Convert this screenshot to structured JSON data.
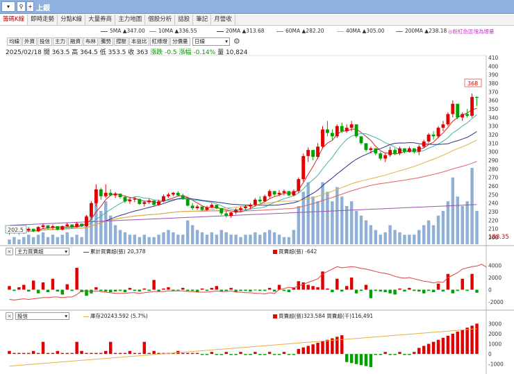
{
  "window": {
    "title": "上銀",
    "search_icon": "magnifier-icon",
    "plus": "+"
  },
  "tabs": [
    {
      "label": "籌碼K線",
      "active": true
    },
    {
      "label": "即時走勢",
      "active": false
    },
    {
      "label": "分點K線",
      "active": false
    },
    {
      "label": "大量券商",
      "active": false
    },
    {
      "label": "主力地圖",
      "active": false
    },
    {
      "label": "個股分析",
      "active": false
    },
    {
      "label": "話股",
      "active": false
    },
    {
      "label": "筆記",
      "active": false
    },
    {
      "label": "月營收",
      "active": false
    }
  ],
  "ma_legend": [
    {
      "label": "5MA ▲347.00",
      "color": "#d22222"
    },
    {
      "label": "10MA ▲336.55",
      "color": "#3fb4a8"
    },
    {
      "label": "20MA ▲313.68",
      "color": "#2b2f8a"
    },
    {
      "label": "60MA ▲282.20",
      "color": "#e06060"
    },
    {
      "label": "40MA ▲305.00",
      "color": "#e0b040"
    },
    {
      "label": "200MA ▲238.18",
      "color": "#9a50b0"
    }
  ],
  "ma_note": "粉紅色區塊為爆量",
  "toolbar": [
    "均線",
    "外資",
    "投信",
    "主力",
    "融資",
    "布林",
    "騰勢",
    "撐壓",
    "本益比",
    "紅綠燈",
    "分價量"
  ],
  "period_select": "日線",
  "info": {
    "date": "2025/02/18",
    "open": "開 363.5",
    "high": "高 364.5",
    "low": "低 353.5",
    "close": "收 363",
    "change": "漲跌 -0.5",
    "pct": "漲幅 -0.14%",
    "volume": "量 10,824"
  },
  "price_axis": [
    "410",
    "400",
    "390",
    "380",
    "370",
    "360",
    "350",
    "340",
    "330",
    "320",
    "310",
    "300",
    "290",
    "280",
    "270",
    "260",
    "250",
    "240",
    "230",
    "220",
    "210",
    "200"
  ],
  "last_price_label": "368",
  "low_label": "202.5",
  "bottom_label": "188.35",
  "panel2": {
    "select": "主力買賣超",
    "legend_a": "累計買賣超(張) 20,378",
    "legend_b": "買賣超(張) -642",
    "axis": [
      "4000",
      "2000",
      "0",
      "-2000"
    ]
  },
  "panel3": {
    "select": "投信",
    "legend_a": "庫存20243.592 (5.7%)",
    "legend_b": "買賣超(張)323.584 買賣超(千)116,491",
    "axis": [
      "3000",
      "2000",
      "1000",
      "0",
      "-1000"
    ]
  },
  "chart_data": {
    "type": "candlestick",
    "ylim": [
      200,
      410
    ],
    "candles": [
      [
        205,
        208,
        203,
        206
      ],
      [
        206,
        210,
        204,
        207
      ],
      [
        207,
        206,
        203,
        205
      ],
      [
        205,
        209,
        204,
        208
      ],
      [
        208,
        212,
        206,
        210
      ],
      [
        210,
        209,
        206,
        207
      ],
      [
        207,
        213,
        206,
        212
      ],
      [
        212,
        216,
        210,
        214
      ],
      [
        214,
        213,
        209,
        211
      ],
      [
        211,
        215,
        209,
        213
      ],
      [
        213,
        212,
        208,
        209
      ],
      [
        209,
        214,
        208,
        213
      ],
      [
        213,
        217,
        212,
        215
      ],
      [
        215,
        214,
        210,
        212
      ],
      [
        212,
        218,
        211,
        216
      ],
      [
        216,
        215,
        212,
        213
      ],
      [
        213,
        226,
        212,
        224
      ],
      [
        224,
        242,
        222,
        240
      ],
      [
        240,
        262,
        236,
        256
      ],
      [
        256,
        258,
        244,
        248
      ],
      [
        248,
        262,
        246,
        252
      ],
      [
        252,
        256,
        248,
        249
      ],
      [
        249,
        253,
        246,
        251
      ],
      [
        251,
        250,
        245,
        247
      ],
      [
        247,
        249,
        240,
        242
      ],
      [
        242,
        246,
        239,
        244
      ],
      [
        244,
        247,
        241,
        245
      ],
      [
        245,
        244,
        238,
        239
      ],
      [
        239,
        243,
        236,
        241
      ],
      [
        241,
        245,
        239,
        243
      ],
      [
        243,
        242,
        237,
        238
      ],
      [
        238,
        244,
        237,
        242
      ],
      [
        242,
        250,
        241,
        248
      ],
      [
        248,
        252,
        246,
        250
      ],
      [
        250,
        253,
        248,
        252
      ],
      [
        252,
        254,
        248,
        249
      ],
      [
        249,
        251,
        244,
        245
      ],
      [
        245,
        246,
        236,
        237
      ],
      [
        237,
        240,
        232,
        234
      ],
      [
        234,
        238,
        232,
        236
      ],
      [
        236,
        235,
        231,
        232
      ],
      [
        232,
        237,
        231,
        235
      ],
      [
        235,
        240,
        234,
        238
      ],
      [
        238,
        237,
        233,
        234
      ],
      [
        234,
        232,
        226,
        228
      ],
      [
        228,
        231,
        223,
        225
      ],
      [
        225,
        230,
        223,
        229
      ],
      [
        229,
        234,
        227,
        232
      ],
      [
        232,
        236,
        230,
        234
      ],
      [
        234,
        238,
        232,
        236
      ],
      [
        236,
        240,
        233,
        238
      ],
      [
        238,
        246,
        236,
        244
      ],
      [
        244,
        248,
        240,
        242
      ],
      [
        242,
        250,
        241,
        248
      ],
      [
        248,
        256,
        246,
        254
      ],
      [
        254,
        253,
        248,
        250
      ],
      [
        250,
        255,
        248,
        252
      ],
      [
        252,
        256,
        249,
        254
      ],
      [
        254,
        252,
        248,
        249
      ],
      [
        249,
        256,
        248,
        254
      ],
      [
        254,
        270,
        252,
        268
      ],
      [
        268,
        298,
        265,
        295
      ],
      [
        295,
        305,
        288,
        302
      ],
      [
        302,
        300,
        290,
        294
      ],
      [
        294,
        310,
        292,
        306
      ],
      [
        306,
        330,
        304,
        326
      ],
      [
        326,
        336,
        318,
        322
      ],
      [
        322,
        326,
        314,
        318
      ],
      [
        318,
        332,
        316,
        330
      ],
      [
        330,
        334,
        322,
        324
      ],
      [
        324,
        332,
        322,
        328
      ],
      [
        328,
        336,
        324,
        332
      ],
      [
        332,
        330,
        316,
        318
      ],
      [
        318,
        315,
        308,
        310
      ],
      [
        310,
        308,
        300,
        302
      ],
      [
        302,
        306,
        298,
        304
      ],
      [
        304,
        302,
        296,
        298
      ],
      [
        298,
        300,
        290,
        292
      ],
      [
        292,
        298,
        288,
        296
      ],
      [
        296,
        306,
        294,
        302
      ],
      [
        302,
        304,
        296,
        298
      ],
      [
        298,
        306,
        296,
        304
      ],
      [
        304,
        302,
        298,
        300
      ],
      [
        300,
        306,
        299,
        304
      ],
      [
        304,
        303,
        298,
        300
      ],
      [
        300,
        308,
        296,
        306
      ],
      [
        306,
        314,
        304,
        312
      ],
      [
        312,
        322,
        310,
        320
      ],
      [
        320,
        324,
        314,
        318
      ],
      [
        318,
        330,
        316,
        328
      ],
      [
        328,
        336,
        324,
        332
      ],
      [
        332,
        346,
        330,
        344
      ],
      [
        344,
        360,
        340,
        356
      ],
      [
        356,
        352,
        338,
        340
      ],
      [
        340,
        346,
        336,
        344
      ],
      [
        344,
        350,
        340,
        342
      ],
      [
        342,
        368,
        340,
        364
      ],
      [
        364,
        364.5,
        353.5,
        363
      ]
    ],
    "volume": [
      2,
      3,
      2,
      3,
      4,
      3,
      4,
      5,
      3,
      4,
      3,
      4,
      5,
      3,
      4,
      3,
      12,
      16,
      20,
      14,
      18,
      12,
      8,
      6,
      5,
      4,
      4,
      3,
      4,
      3,
      3,
      4,
      5,
      6,
      5,
      4,
      4,
      10,
      8,
      6,
      5,
      4,
      5,
      4,
      6,
      5,
      4,
      4,
      3,
      4,
      4,
      5,
      4,
      5,
      6,
      5,
      4,
      3,
      3,
      6,
      16,
      22,
      26,
      20,
      18,
      26,
      22,
      18,
      24,
      20,
      16,
      18,
      14,
      12,
      10,
      8,
      6,
      4,
      5,
      8,
      6,
      5,
      4,
      4,
      4,
      6,
      8,
      10,
      8,
      12,
      14,
      18,
      28,
      20,
      16,
      18,
      32,
      14
    ],
    "panel2_bars": [
      600,
      -200,
      400,
      800,
      -300,
      1500,
      -600,
      1200,
      -400,
      1800,
      -300,
      -800,
      900,
      -200,
      3600,
      -400,
      -1000,
      -600,
      400,
      -200,
      -300,
      -400,
      -300,
      -200,
      -400,
      300,
      -200,
      -300,
      200,
      -200,
      1600,
      -300,
      200,
      400,
      -200,
      -100,
      300,
      -200,
      -200,
      -400,
      200,
      -200,
      300,
      600,
      -300,
      -200,
      300,
      -400,
      -200,
      -200,
      -300,
      -100,
      -200,
      -200,
      300,
      -300,
      800,
      -200,
      -400,
      300,
      1400,
      1200,
      800,
      600,
      400,
      3000,
      200,
      -400,
      1800,
      -300,
      600,
      2000,
      -600,
      -200,
      800,
      -1400,
      -200,
      -300,
      -400,
      -600,
      -800,
      200,
      -300,
      300,
      -200,
      -300,
      -600,
      -200,
      -400,
      1000,
      -300,
      2600,
      -600,
      -200,
      1800,
      -200,
      2600,
      -500
    ],
    "panel2_line": [
      -1600,
      -1700,
      -1600,
      -1500,
      -1600,
      -1500,
      -1400,
      -1300,
      -1300,
      -1200,
      -1200,
      -1300,
      -1200,
      -1200,
      -800,
      -200,
      -200,
      -300,
      -200,
      -300,
      -400,
      -500,
      -600,
      -600,
      -600,
      -500,
      -500,
      -600,
      -500,
      -400,
      -300,
      -300,
      -300,
      -200,
      -200,
      -200,
      -200,
      -300,
      -300,
      -400,
      -400,
      -400,
      -300,
      -200,
      -300,
      -300,
      -200,
      -400,
      -400,
      -500,
      -500,
      -600,
      -600,
      -700,
      -500,
      -600,
      0,
      200,
      400,
      300,
      600,
      900,
      1200,
      1500,
      1800,
      2600,
      3000,
      3400,
      3800,
      3600,
      3700,
      3800,
      3700,
      3500,
      3400,
      3200,
      3000,
      2800,
      2700,
      2500,
      2200,
      2000,
      1900,
      2000,
      1800,
      1600,
      1400,
      1300,
      1100,
      1300,
      1200,
      2000,
      2400,
      2800,
      3400,
      3600,
      3800,
      3900,
      4200,
      3700
    ]
  }
}
